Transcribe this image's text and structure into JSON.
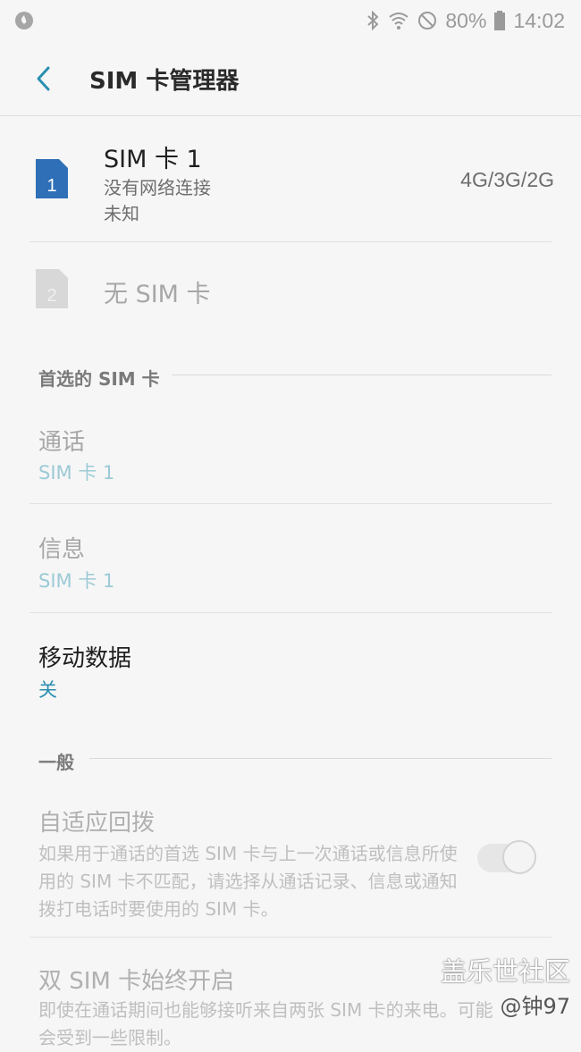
{
  "status_bar": {
    "battery_percent": "80%",
    "time": "14:02"
  },
  "app_bar": {
    "title": "SIM 卡管理器"
  },
  "sim_slots": [
    {
      "number": "1",
      "name": "SIM 卡 1",
      "status": "没有网络连接",
      "detail": "未知",
      "network": "4G/3G/2G",
      "color": "#2e6fb7"
    },
    {
      "number": "2",
      "name": "无 SIM 卡",
      "color": "#d8d8d8"
    }
  ],
  "preferred_sim": {
    "heading": "首选的 SIM 卡",
    "calls": {
      "label": "通话",
      "value": "SIM 卡 1"
    },
    "messages": {
      "label": "信息",
      "value": "SIM 卡 1"
    },
    "mobile_data": {
      "label": "移动数据",
      "value": "关"
    }
  },
  "general": {
    "heading": "一般",
    "adaptive_callback": {
      "label": "自适应回拨",
      "description": "如果用于通话的首选 SIM 卡与上一次通话或信息所使用的 SIM 卡不匹配，请选择从通话记录、信息或通知拨打电话时要使用的 SIM 卡。",
      "enabled": false
    },
    "dual_sim_always_on": {
      "label": "双 SIM 卡始终开启",
      "description": "即使在通话期间也能够接听来自两张 SIM 卡的来电。可能会受到一些限制。"
    }
  },
  "watermark": {
    "line1": "盖乐世社区",
    "line2": "@钟97"
  }
}
